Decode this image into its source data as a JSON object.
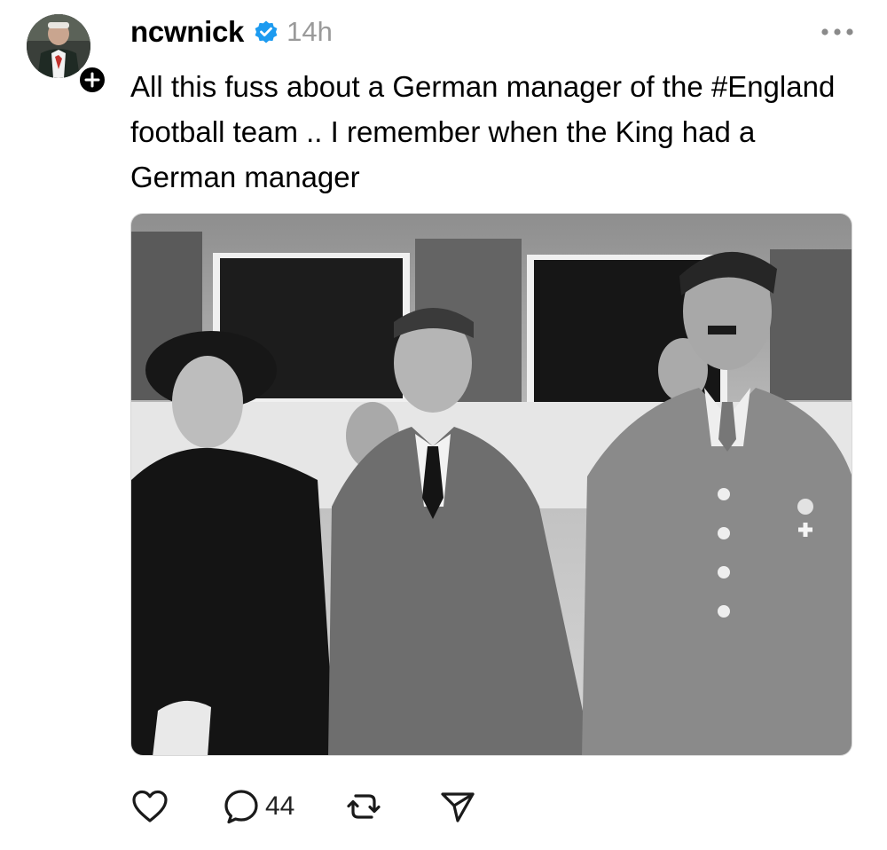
{
  "post": {
    "username": "ncwnick",
    "timestamp": "14h",
    "text": "All this fuss about a German manager of the #England football team .. I remember when the King had a German manager",
    "reply_count": "44"
  },
  "icons": {
    "avatar": "profile-photo",
    "follow_badge": "plus-icon",
    "verified": "verified-badge-icon",
    "more": "ellipsis-icon",
    "like": "heart-icon",
    "reply": "speech-bubble-icon",
    "repost": "repost-icon",
    "share": "paper-plane-icon"
  },
  "colors": {
    "verified_blue": "#1d9bf0",
    "timestamp_gray": "#9a9a9a",
    "text": "#000000"
  }
}
